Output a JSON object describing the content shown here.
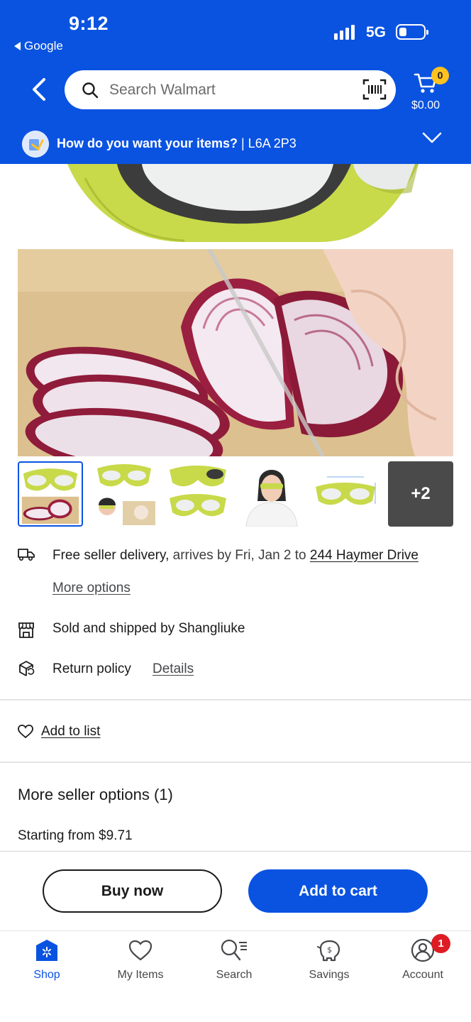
{
  "status_bar": {
    "time": "9:12",
    "back_app": "Google",
    "network": "5G"
  },
  "header": {
    "search_placeholder": "Search Walmart",
    "cart_count": "0",
    "cart_total": "$0.00",
    "delivery_question": "How do you want your items?",
    "delivery_postal": " | L6A 2P3"
  },
  "gallery": {
    "more_count": "+2"
  },
  "info": {
    "shipping_bold": "Free seller delivery,",
    "shipping_rest": " arrives by Fri, Jan 2 to ",
    "shipping_address": "244 Haymer Drive",
    "more_options": "More options",
    "sold_by": "Sold and shipped by Shangliuke",
    "return_policy": "Return policy",
    "details": "Details"
  },
  "add_to_list": "Add to list",
  "seller_options": {
    "title": "More seller options (1)",
    "starting": "Starting from $9.71"
  },
  "actions": {
    "buy_now": "Buy now",
    "add_to_cart": "Add to cart"
  },
  "tabbar": {
    "tabs": [
      {
        "label": "Shop",
        "icon": "shop-spark-icon"
      },
      {
        "label": "My Items",
        "icon": "heart-icon"
      },
      {
        "label": "Search",
        "icon": "search-list-icon"
      },
      {
        "label": "Savings",
        "icon": "piggy-bank-icon"
      },
      {
        "label": "Account",
        "icon": "account-icon"
      }
    ],
    "account_badge": "1"
  },
  "colors": {
    "brand_blue": "#0a53e1",
    "spark_yellow": "#ffc220",
    "badge_red": "#de1c24",
    "goggle_green": "#c8d94a"
  }
}
